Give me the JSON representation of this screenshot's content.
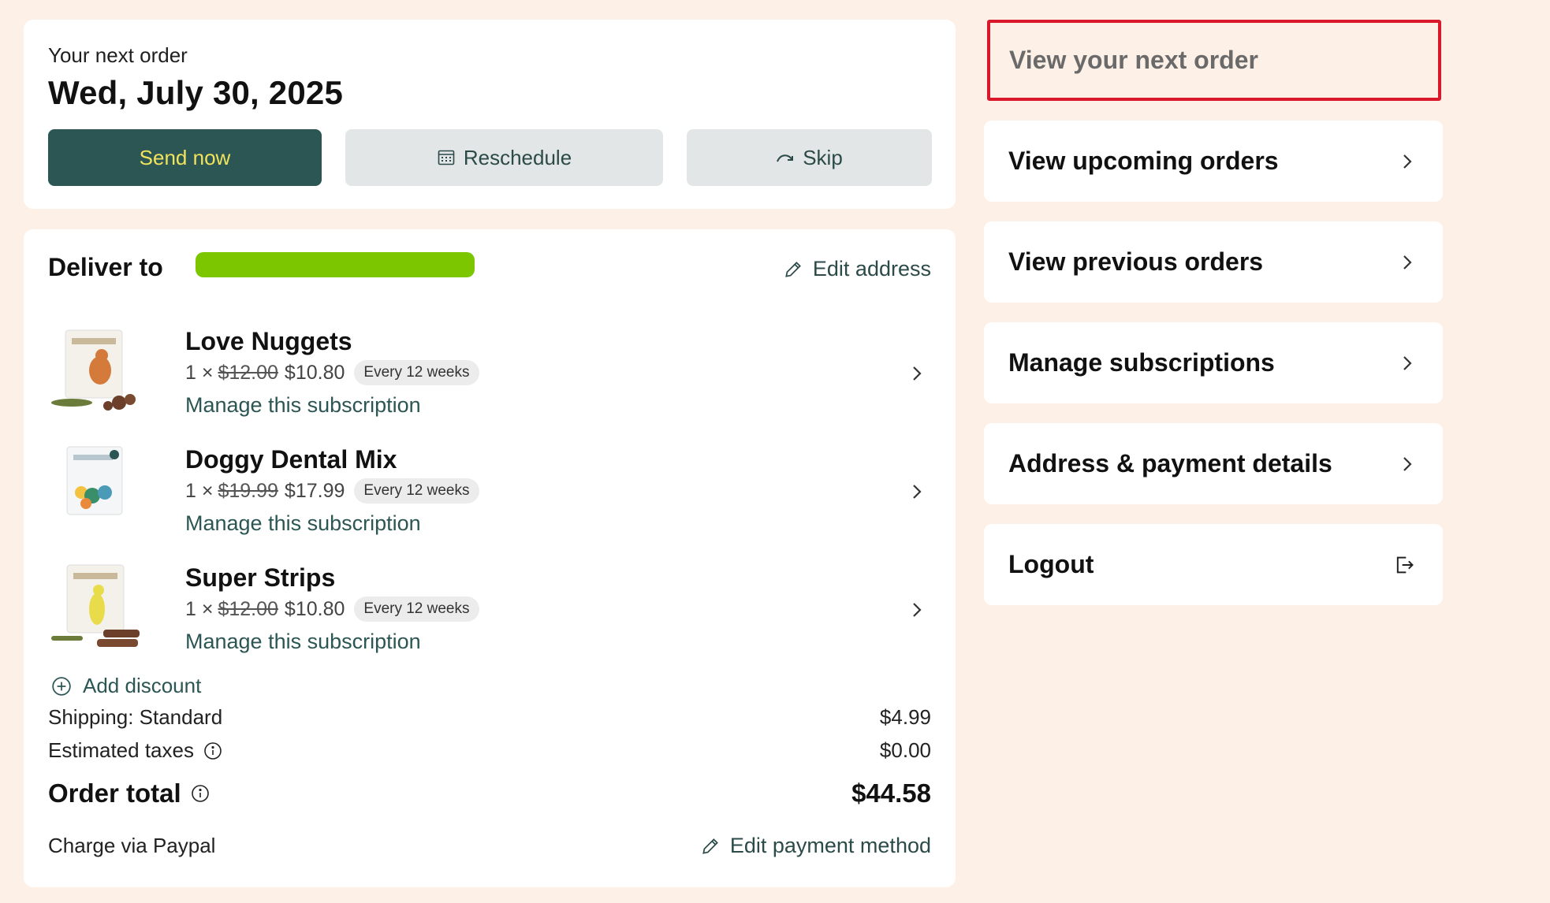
{
  "next_order": {
    "label": "Your next order",
    "date": "Wed, July 30, 2025",
    "send_now": "Send now",
    "reschedule": "Reschedule",
    "skip": "Skip"
  },
  "delivery": {
    "title": "Deliver to",
    "edit_address": "Edit address"
  },
  "products": [
    {
      "name": "Love Nuggets",
      "qty": "1 ×",
      "old_price": "$12.00",
      "new_price": "$10.80",
      "frequency": "Every 12 weeks",
      "manage": "Manage this subscription"
    },
    {
      "name": "Doggy Dental Mix",
      "qty": "1 ×",
      "old_price": "$19.99",
      "new_price": "$17.99",
      "frequency": "Every 12 weeks",
      "manage": "Manage this subscription"
    },
    {
      "name": "Super Strips",
      "qty": "1 ×",
      "old_price": "$12.00",
      "new_price": "$10.80",
      "frequency": "Every 12 weeks",
      "manage": "Manage this subscription"
    }
  ],
  "summary": {
    "add_discount": "Add discount",
    "shipping_label": "Shipping: Standard",
    "shipping_value": "$4.99",
    "taxes_label": "Estimated taxes",
    "taxes_value": "$0.00",
    "total_label": "Order total",
    "total_value": "$44.58",
    "charge_via": "Charge via Paypal",
    "edit_payment": "Edit payment method"
  },
  "nav": {
    "view_next": "View your next order",
    "upcoming": "View upcoming orders",
    "previous": "View previous orders",
    "subscriptions": "Manage subscriptions",
    "address_payment": "Address & payment details",
    "logout": "Logout"
  },
  "colors": {
    "background": "#fdf0e6",
    "primary_button": "#2b5653",
    "primary_button_text": "#f2e35d",
    "secondary_button": "#e2e6e6",
    "active_border": "#d9182b",
    "redaction": "#7cc600"
  }
}
